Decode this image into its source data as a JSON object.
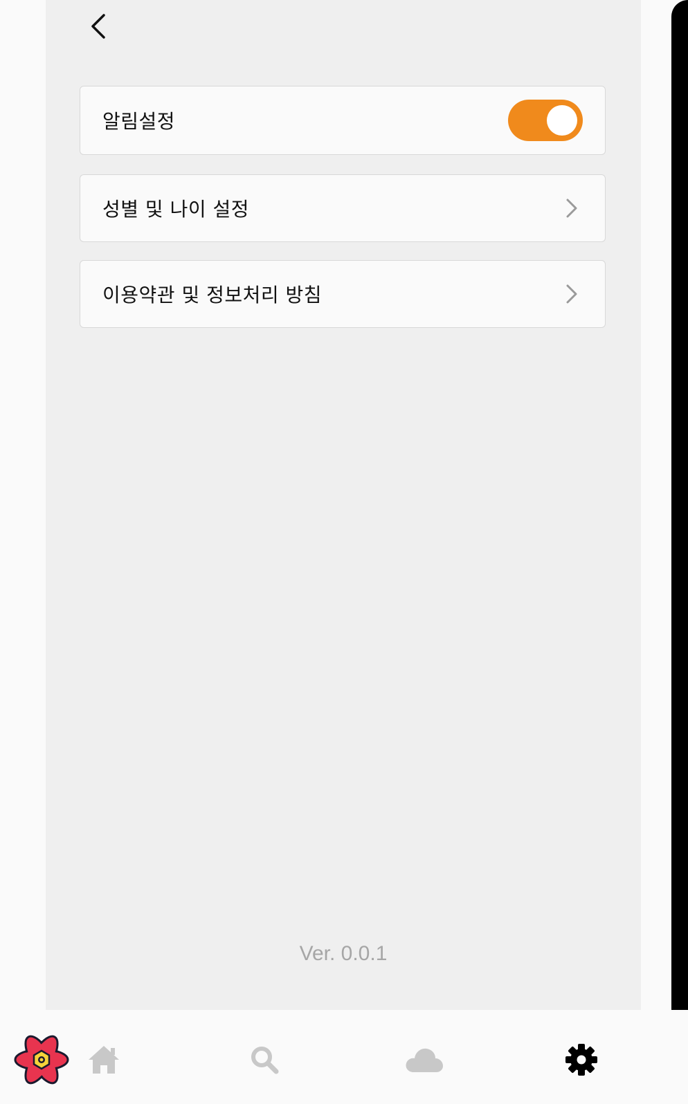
{
  "header": {
    "back_icon": "chevron-left-icon"
  },
  "settings": {
    "items": [
      {
        "label": "알림설정",
        "control": "toggle",
        "toggle_on": true
      },
      {
        "label": "성별 및 나이 설정",
        "control": "chevron-right-icon"
      },
      {
        "label": "이용약관 및 정보처리 방침",
        "control": "chevron-right-icon"
      }
    ]
  },
  "version": "Ver. 0.0.1",
  "tabbar": {
    "tabs": [
      {
        "icon": "home-icon",
        "active": false
      },
      {
        "icon": "search-icon",
        "active": false
      },
      {
        "icon": "cloud-icon",
        "active": false
      },
      {
        "icon": "gear-icon",
        "active": true
      }
    ],
    "logo": "react-logo"
  },
  "colors": {
    "accent": "#f08a1c",
    "background": "#efefef",
    "card": "#fafafa",
    "inactive_icon": "#c8c8c8",
    "active_icon": "#000000",
    "version_text": "#a6a6a6"
  }
}
